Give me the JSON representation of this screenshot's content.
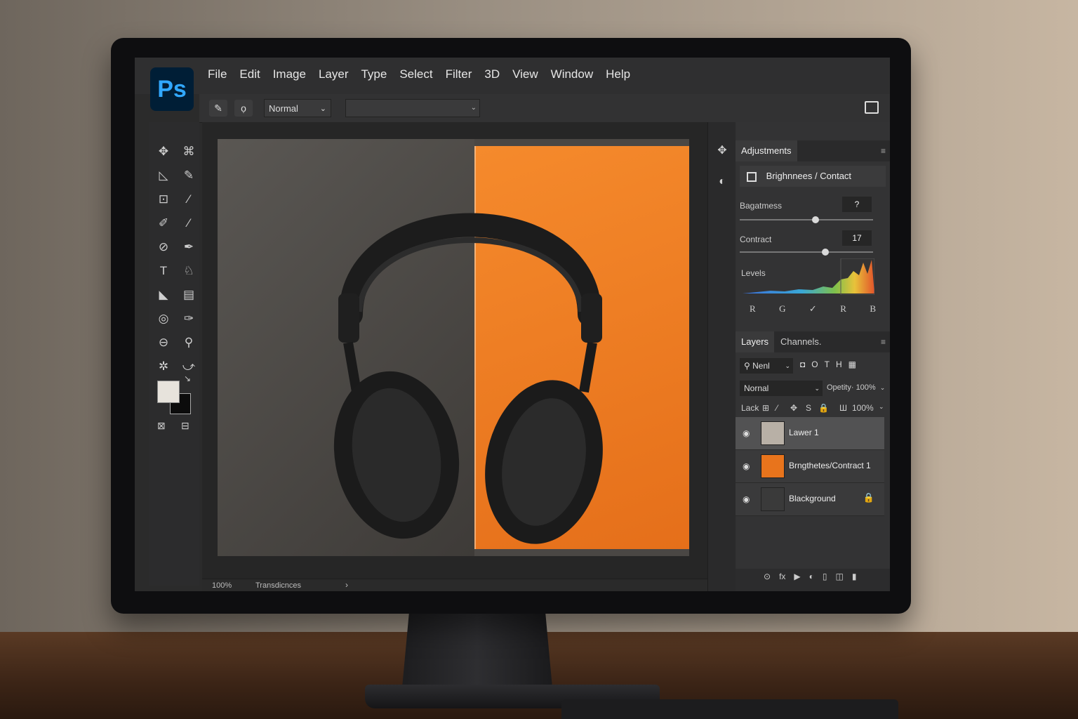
{
  "app": {
    "logo": "Ps"
  },
  "menu": [
    "File",
    "Edit",
    "Image",
    "Layer",
    "Type",
    "Select",
    "Filter",
    "3D",
    "View",
    "Window",
    "Help"
  ],
  "options_bar": {
    "mode": "Normal",
    "chevron": "⌄",
    "more": "•••"
  },
  "tools": [
    {
      "name": "move-tool-icon",
      "glyph": "✥"
    },
    {
      "name": "artboard-tool-icon",
      "glyph": "⌘"
    },
    {
      "name": "polygon-lasso-icon",
      "glyph": "◺"
    },
    {
      "name": "quick-select-icon",
      "glyph": "✎"
    },
    {
      "name": "crop-tool-icon",
      "glyph": "⊡"
    },
    {
      "name": "eyedropper-icon",
      "glyph": "⁄"
    },
    {
      "name": "healing-brush-icon",
      "glyph": "✐"
    },
    {
      "name": "brush-tool-icon",
      "glyph": "⁄"
    },
    {
      "name": "clone-stamp-icon",
      "glyph": "⊘"
    },
    {
      "name": "history-brush-icon",
      "glyph": "✒"
    },
    {
      "name": "type-tool-icon",
      "glyph": "T"
    },
    {
      "name": "pen-tool-icon",
      "glyph": "♘"
    },
    {
      "name": "path-select-icon",
      "glyph": "◣"
    },
    {
      "name": "rectangle-tool-icon",
      "glyph": "▤"
    },
    {
      "name": "hand-tool-icon",
      "glyph": "◎"
    },
    {
      "name": "smudge-tool-icon",
      "glyph": "✑"
    },
    {
      "name": "zoom-out-icon",
      "glyph": "⊖"
    },
    {
      "name": "zoom-tool-icon",
      "glyph": "⚲"
    },
    {
      "name": "edit-toolbar-icon",
      "glyph": "✲"
    },
    {
      "name": "extra-tools-icon",
      "glyph": "⤻"
    }
  ],
  "swatches": {
    "foreground": "#e7e3dc",
    "background": "#0c0c0c"
  },
  "status_bar": {
    "zoom": "100%",
    "info": "Transdicnces",
    "arrow": "›"
  },
  "adjustments": {
    "tab": "Adjustments",
    "title": "Brighnnees / Contact",
    "sliders": [
      {
        "label": "Bagatmess",
        "value": "?",
        "position": 0.57
      },
      {
        "label": "Contract",
        "value": "17",
        "position": 0.64
      }
    ],
    "levels_label": "Levels",
    "channels": [
      "R",
      "G",
      "✓",
      "R",
      "B"
    ]
  },
  "layers_panel": {
    "tabs": [
      "Layers",
      "Channels."
    ],
    "search": "Nenl",
    "filter_icons": [
      "◘",
      "O",
      "T",
      "H",
      "▦"
    ],
    "blend_mode": "Nornal",
    "opacity": "Opetity· 100%",
    "lock_label": "Lack",
    "lock_icons": [
      "⊞",
      "⁄",
      "✥",
      "S",
      "🔒"
    ],
    "fill": "100%",
    "layers": [
      {
        "name": "Lawer 1",
        "thumb": "#b8b0a6",
        "selected": true,
        "locked": false
      },
      {
        "name": "Brngthetes/Contract 1",
        "thumb": "#e8741c",
        "selected": false,
        "locked": false
      },
      {
        "name": "Blackground",
        "thumb": "#3a3a3a",
        "selected": false,
        "locked": true
      }
    ],
    "footer_icons": [
      "⊙",
      "fx",
      "▶",
      "◐",
      "▯",
      "◫",
      "▮"
    ]
  },
  "colors": {
    "accent": "#31a8ff",
    "canvas_orange": "#f08023",
    "canvas_gray": "#4d4a47"
  }
}
